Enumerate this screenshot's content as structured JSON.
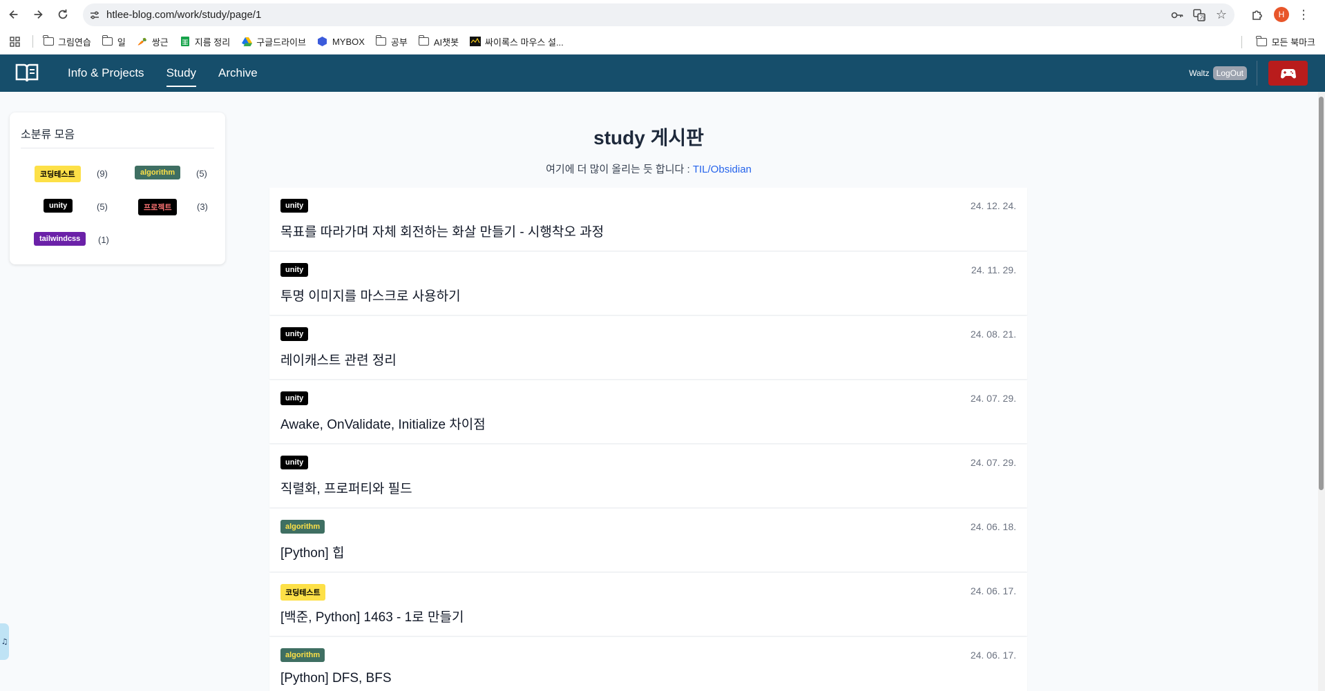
{
  "browser": {
    "url": "htlee-blog.com/work/study/page/1",
    "profile_initial": "H",
    "bookmarks": [
      {
        "label": "그림연습",
        "icon": "folder-icon"
      },
      {
        "label": "일",
        "icon": "folder-icon"
      },
      {
        "label": "쌍근",
        "icon": "carrot-icon"
      },
      {
        "label": "지름 정리",
        "icon": "sheets-icon"
      },
      {
        "label": "구글드라이브",
        "icon": "drive-icon"
      },
      {
        "label": "MYBOX",
        "icon": "mybox-icon"
      },
      {
        "label": "공부",
        "icon": "folder-icon"
      },
      {
        "label": "AI챗봇",
        "icon": "folder-icon"
      },
      {
        "label": "싸이록스 마우스 설...",
        "icon": "mouse-site-icon"
      }
    ],
    "all_bookmarks_label": "모든 북마크"
  },
  "header": {
    "nav": [
      {
        "label": "Info & Projects",
        "active": false
      },
      {
        "label": "Study",
        "active": true
      },
      {
        "label": "Archive",
        "active": false
      }
    ],
    "user_name": "Waltz",
    "logout_label": "LogOut",
    "brand_color": "#164e6b",
    "game_button_color": "#b91c1c"
  },
  "sidebar": {
    "title": "소분류 모음",
    "categories": [
      {
        "label": "코딩테스트",
        "count": "(9)",
        "style": "coding"
      },
      {
        "label": "algorithm",
        "count": "(5)",
        "style": "algo"
      },
      {
        "label": "unity",
        "count": "(5)",
        "style": "unity"
      },
      {
        "label": "프로젝트",
        "count": "(3)",
        "style": "project"
      },
      {
        "label": "tailwindcss",
        "count": "(1)",
        "style": "tailwind"
      }
    ]
  },
  "main": {
    "title": "study 게시판",
    "subtitle_prefix": "여기에 더 많이 올리는 듯 합니다 :",
    "subtitle_link": "TIL/Obsidian",
    "posts": [
      {
        "tag": "unity",
        "style": "unity",
        "date": "24. 12. 24.",
        "title": "목표를 따라가며 자체 회전하는 화살 만들기 - 시행착오 과정"
      },
      {
        "tag": "unity",
        "style": "unity",
        "date": "24. 11. 29.",
        "title": "투명 이미지를 마스크로 사용하기"
      },
      {
        "tag": "unity",
        "style": "unity",
        "date": "24. 08. 21.",
        "title": "레이캐스트 관련 정리"
      },
      {
        "tag": "unity",
        "style": "unity",
        "date": "24. 07. 29.",
        "title": "Awake, OnValidate, Initialize 차이점"
      },
      {
        "tag": "unity",
        "style": "unity",
        "date": "24. 07. 29.",
        "title": "직렬화, 프로퍼티와 필드"
      },
      {
        "tag": "algorithm",
        "style": "algo",
        "date": "24. 06. 18.",
        "title": "[Python] 힙"
      },
      {
        "tag": "코딩테스트",
        "style": "coding",
        "date": "24. 06. 17.",
        "title": "[백준, Python] 1463 - 1로 만들기"
      },
      {
        "tag": "algorithm",
        "style": "algo",
        "date": "24. 06. 17.",
        "title": "[Python] DFS, BFS"
      }
    ]
  },
  "music_tab_icon": "music-note-icon"
}
